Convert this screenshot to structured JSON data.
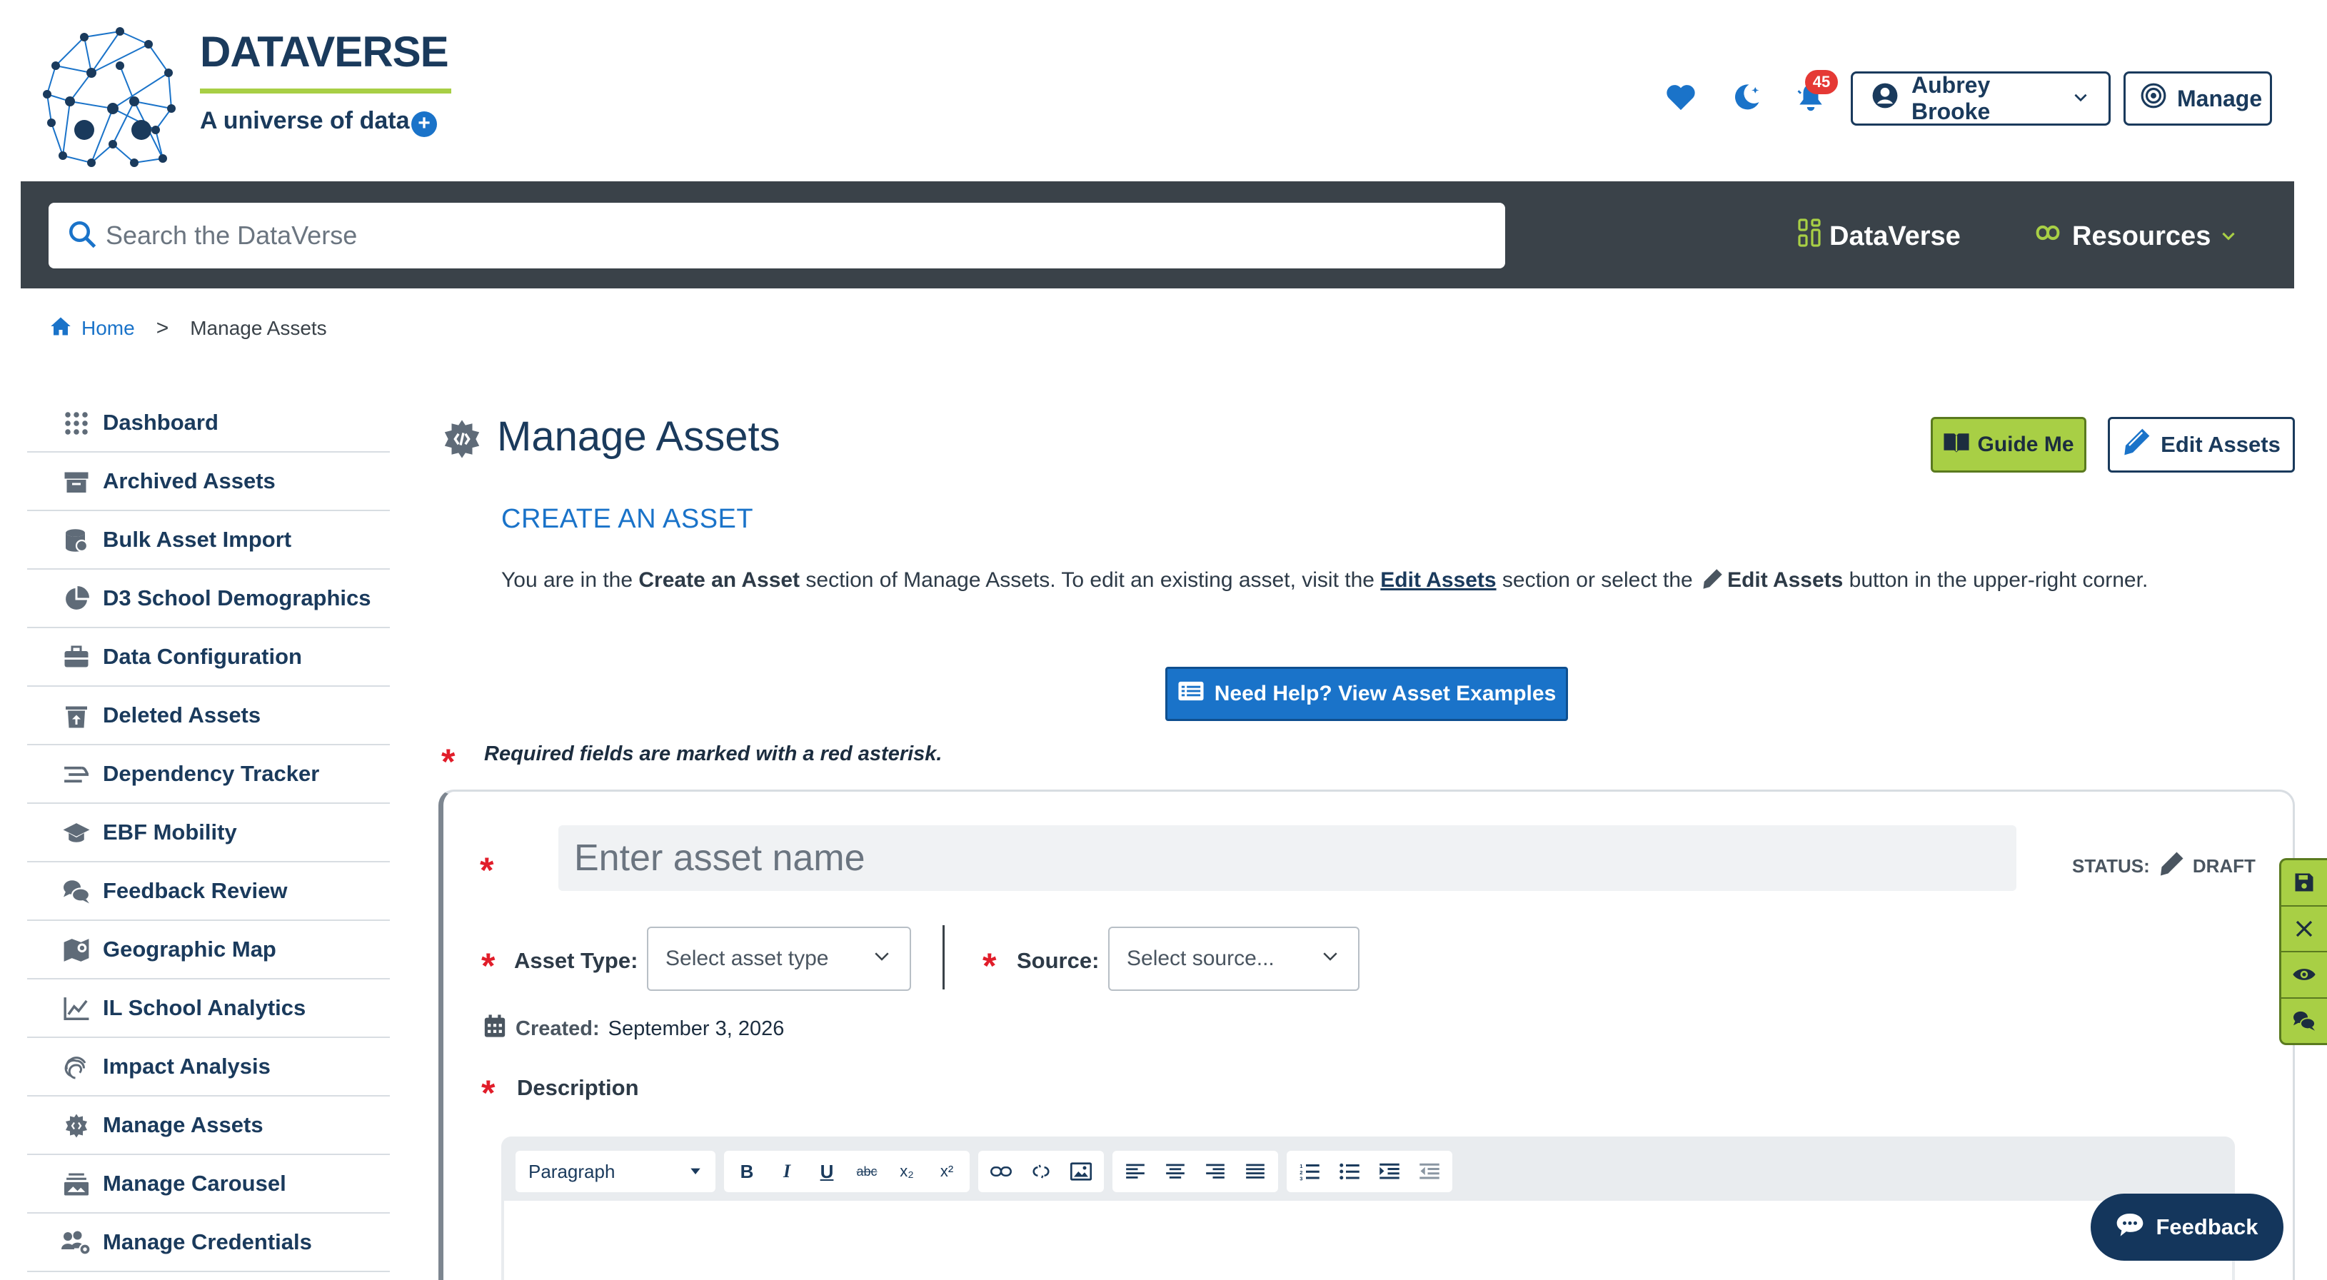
{
  "brand": {
    "title": "DATAVERSE",
    "tagline": "A universe of data",
    "plus": "+"
  },
  "header": {
    "favorites_icon": "heart-icon",
    "theme_icon": "moon-icon",
    "notifications_icon": "bell-icon",
    "notification_count": "45",
    "user_name": "Aubrey Brooke",
    "manage_label": "Manage"
  },
  "navbar": {
    "search_placeholder": "Search the DataVerse",
    "links": [
      {
        "label": "DataVerse",
        "icon": "dataverse-icon"
      },
      {
        "label": "Resources",
        "icon": "resources-icon"
      }
    ]
  },
  "breadcrumb": {
    "home": "Home",
    "separator": ">",
    "current": "Manage Assets"
  },
  "sidebar": {
    "items": [
      {
        "label": "Dashboard",
        "icon": "grid-icon"
      },
      {
        "label": "Archived Assets",
        "icon": "archive-icon"
      },
      {
        "label": "Bulk Asset Import",
        "icon": "database-icon"
      },
      {
        "label": "D3 School Demographics",
        "icon": "pie-chart-icon"
      },
      {
        "label": "Data Configuration",
        "icon": "toolbox-icon"
      },
      {
        "label": "Deleted Assets",
        "icon": "trash-restore-icon"
      },
      {
        "label": "Dependency Tracker",
        "icon": "stream-icon"
      },
      {
        "label": "EBF Mobility",
        "icon": "graduation-cap-icon"
      },
      {
        "label": "Feedback Review",
        "icon": "comments-icon"
      },
      {
        "label": "Geographic Map",
        "icon": "map-icon"
      },
      {
        "label": "IL School Analytics",
        "icon": "line-chart-icon"
      },
      {
        "label": "Impact Analysis",
        "icon": "fingerprint-icon"
      },
      {
        "label": "Manage Assets",
        "icon": "gear-code-icon"
      },
      {
        "label": "Manage Carousel",
        "icon": "carousel-icon"
      },
      {
        "label": "Manage Credentials",
        "icon": "users-gear-icon"
      }
    ]
  },
  "main": {
    "title": "Manage Assets",
    "guide_me": "Guide Me",
    "edit_assets": "Edit Assets",
    "section_title": "CREATE AN ASSET",
    "intro": {
      "p1": "You are in the ",
      "b1": "Create an Asset",
      "p2": " section of Manage Assets. To edit an existing asset, visit the ",
      "link": "Edit Assets",
      "p3": " section or select the ",
      "b2": "Edit Assets",
      "p4": " button in the upper-right corner."
    },
    "help_button": "Need Help? View Asset Examples",
    "required_note": "Required fields are marked with a red asterisk.",
    "required_star": "*"
  },
  "form": {
    "name_placeholder": "Enter asset name",
    "status_label": "STATUS:",
    "status_value": "DRAFT",
    "asset_type_label": "Asset Type:",
    "asset_type_placeholder": "Select asset type",
    "source_label": "Source:",
    "source_placeholder": "Select source...",
    "created_label": "Created:",
    "created_value": "September 3, 2026",
    "description_label": "Description"
  },
  "editor": {
    "block_format": "Paragraph",
    "buttons": [
      "B",
      "I",
      "U",
      "abc",
      "x₂",
      "x²"
    ]
  },
  "side_tools": [
    "save-icon",
    "close-icon",
    "eye-icon",
    "comments-icon"
  ],
  "feedback": {
    "label": "Feedback"
  },
  "colors": {
    "navy": "#1a3a5c",
    "blue": "#1a73c9",
    "green": "#a8cf45",
    "navbar": "#3a4249",
    "required": "#e11d2a"
  }
}
